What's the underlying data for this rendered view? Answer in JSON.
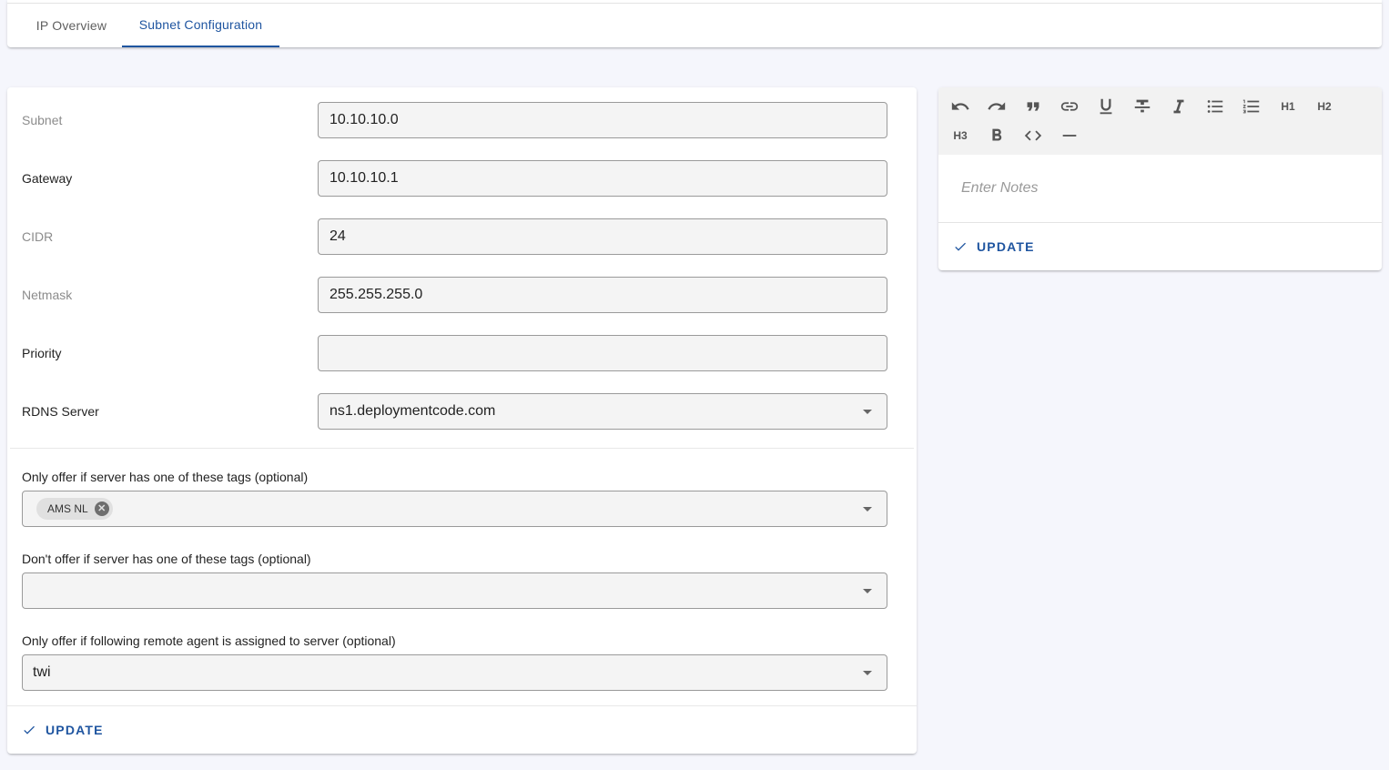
{
  "tabs": [
    {
      "label": "IP Overview",
      "active": false
    },
    {
      "label": "Subnet Configuration",
      "active": true
    }
  ],
  "form": {
    "subnet": {
      "label": "Subnet",
      "value": "10.10.10.0"
    },
    "gateway": {
      "label": "Gateway",
      "value": "10.10.10.1"
    },
    "cidr": {
      "label": "CIDR",
      "value": "24"
    },
    "netmask": {
      "label": "Netmask",
      "value": "255.255.255.0"
    },
    "priority": {
      "label": "Priority",
      "value": ""
    },
    "rdns": {
      "label": "RDNS Server",
      "value": "ns1.deploymentcode.com"
    },
    "include_tags": {
      "label": "Only offer if server has one of these tags (optional)",
      "chips": [
        "AMS NL"
      ]
    },
    "exclude_tags": {
      "label": "Don't offer if server has one of these tags (optional)",
      "value": ""
    },
    "remote_agent": {
      "label": "Only offer if following remote agent is assigned to server (optional)",
      "value": "twi"
    },
    "update_label": "UPDATE"
  },
  "notes": {
    "placeholder": "Enter Notes",
    "toolbar": [
      "undo-icon",
      "redo-icon",
      "blockquote-icon",
      "link-icon",
      "underline-icon",
      "strikethrough-icon",
      "italic-icon",
      "bullet-list-icon",
      "ordered-list-icon",
      "H1",
      "H2",
      "H3",
      "bold-icon",
      "code-icon",
      "horizontal-rule-icon"
    ],
    "h1": "H1",
    "h2": "H2",
    "h3": "H3",
    "update_label": "UPDATE"
  },
  "colors": {
    "accent": "#1f55a0",
    "background": "#f5f6fc"
  }
}
